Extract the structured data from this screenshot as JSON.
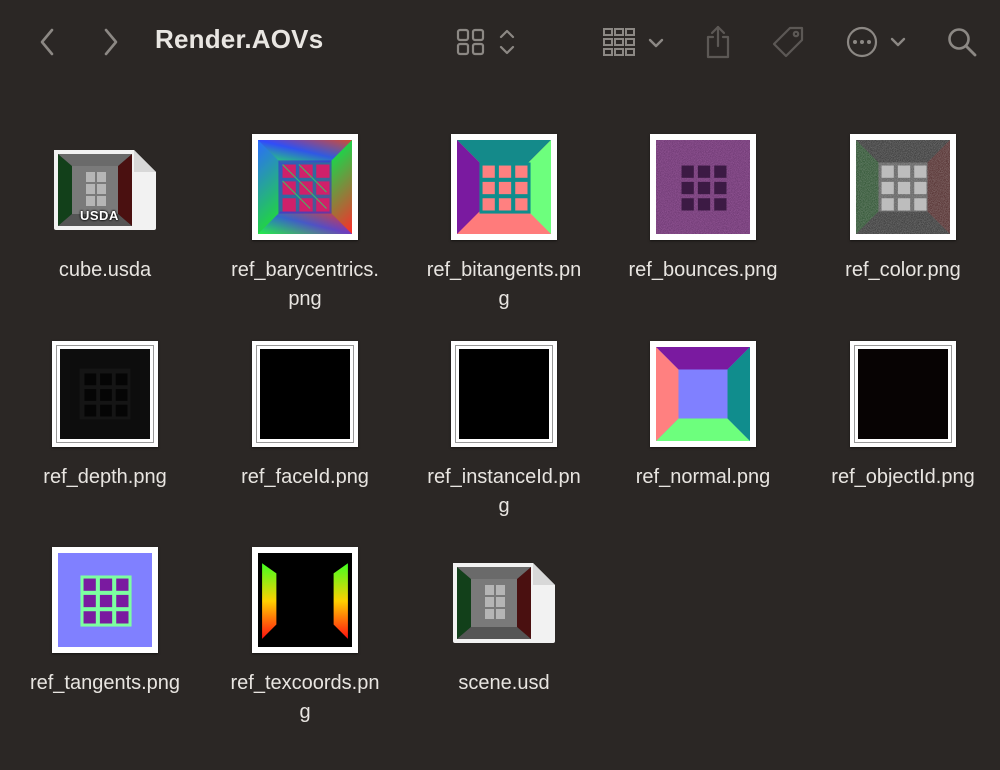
{
  "window": {
    "title": "Render.AOVs"
  },
  "toolbar": {
    "back_icon": "chevron-left-icon",
    "forward_icon": "chevron-right-icon",
    "view_icon": "icon-grid-view-icon",
    "group_icon": "group-by-icon",
    "share_icon": "share-icon",
    "tag_icon": "tag-icon",
    "more_icon": "ellipsis-circle-icon",
    "search_icon": "search-icon"
  },
  "files": [
    {
      "name": "cube.usda",
      "line1": "cube.usda",
      "line2": "",
      "kind": "usd",
      "badge": "USDA"
    },
    {
      "name": "ref_barycentrics.png",
      "line1": "ref_barycentrics.",
      "line2": "png",
      "kind": "barycentrics"
    },
    {
      "name": "ref_bitangents.png",
      "line1": "ref_bitangents.pn",
      "line2": "g",
      "kind": "bitangents"
    },
    {
      "name": "ref_bounces.png",
      "line1": "ref_bounces.png",
      "line2": "",
      "kind": "bounces"
    },
    {
      "name": "ref_color.png",
      "line1": "ref_color.png",
      "line2": "",
      "kind": "color"
    },
    {
      "name": "ref_depth.png",
      "line1": "ref_depth.png",
      "line2": "",
      "kind": "depth"
    },
    {
      "name": "ref_faceId.png",
      "line1": "ref_faceId.png",
      "line2": "",
      "kind": "black"
    },
    {
      "name": "ref_instanceId.png",
      "line1": "ref_instanceId.pn",
      "line2": "g",
      "kind": "black"
    },
    {
      "name": "ref_normal.png",
      "line1": "ref_normal.png",
      "line2": "",
      "kind": "normal"
    },
    {
      "name": "ref_objectId.png",
      "line1": "ref_objectId.png",
      "line2": "",
      "kind": "black2"
    },
    {
      "name": "ref_tangents.png",
      "line1": "ref_tangents.png",
      "line2": "",
      "kind": "tangents"
    },
    {
      "name": "ref_texcoords.png",
      "line1": "ref_texcoords.pn",
      "line2": "g",
      "kind": "texcoords"
    },
    {
      "name": "scene.usd",
      "line1": "scene.usd",
      "line2": "",
      "kind": "usd",
      "badge": ""
    }
  ]
}
